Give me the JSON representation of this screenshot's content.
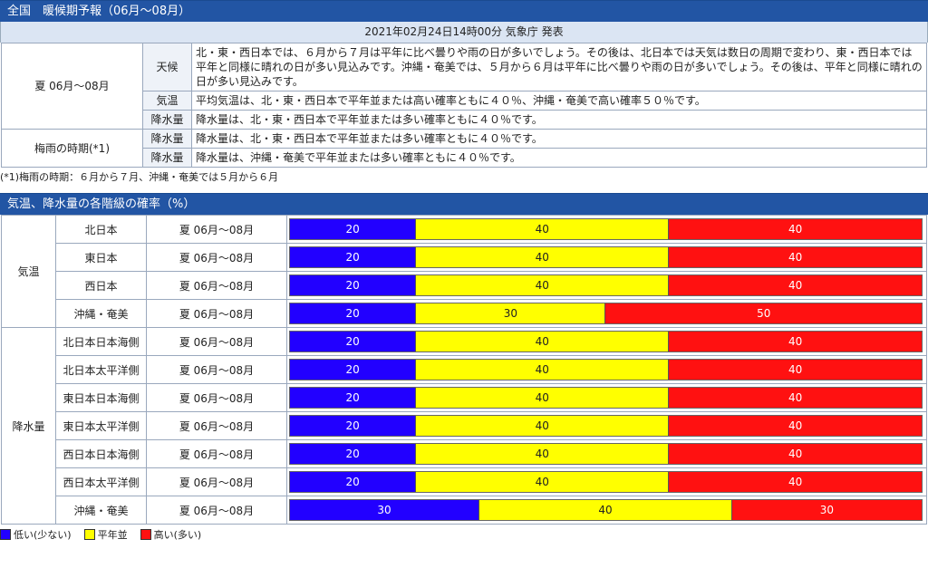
{
  "header": {
    "title": "全国　暖候期予報（06月～08月）"
  },
  "issued": "2021年02月24日14時00分 気象庁 発表",
  "forecast": {
    "summer_period": "夏 06月～08月",
    "weather_label": "天候",
    "weather_text": "北・東・西日本では、６月から７月は平年に比べ曇りや雨の日が多いでしょう。その後は、北日本では天気は数日の周期で変わり、東・西日本では平年と同様に晴れの日が多い見込みです。沖縄・奄美では、５月から６月は平年に比べ曇りや雨の日が多いでしょう。その後は、平年と同様に晴れの日が多い見込みです。",
    "temp_label": "気温",
    "temp_text": "平均気温は、北・東・西日本で平年並または高い確率ともに４０％、沖縄・奄美で高い確率５０％です。",
    "precip_label": "降水量",
    "precip_text": "降水量は、北・東・西日本で平年並または多い確率ともに４０％です。",
    "rainy_period": "梅雨の時期(*1)",
    "rainy_label1": "降水量",
    "rainy_text1": "降水量は、北・東・西日本で平年並または多い確率ともに４０％です。",
    "rainy_label2": "降水量",
    "rainy_text2": "降水量は、沖縄・奄美で平年並または多い確率ともに４０％です。"
  },
  "note": "(*1)梅雨の時期：６月から７月、沖縄・奄美では５月から６月",
  "prob_header": "気温、降水量の各階級の確率（%）",
  "colors": {
    "low": "#2200ff",
    "normal": "#ffff00",
    "high": "#ff1111",
    "header": "#2255a4"
  },
  "temp_group": {
    "label": "気温",
    "rows": [
      {
        "region": "北日本",
        "period": "夏 06月～08月",
        "low": 20,
        "normal": 40,
        "high": 40
      },
      {
        "region": "東日本",
        "period": "夏 06月～08月",
        "low": 20,
        "normal": 40,
        "high": 40
      },
      {
        "region": "西日本",
        "period": "夏 06月～08月",
        "low": 20,
        "normal": 40,
        "high": 40
      },
      {
        "region": "沖縄・奄美",
        "period": "夏 06月～08月",
        "low": 20,
        "normal": 30,
        "high": 50
      }
    ]
  },
  "precip_group": {
    "label": "降水量",
    "rows": [
      {
        "region": "北日本日本海側",
        "period": "夏 06月～08月",
        "low": 20,
        "normal": 40,
        "high": 40
      },
      {
        "region": "北日本太平洋側",
        "period": "夏 06月～08月",
        "low": 20,
        "normal": 40,
        "high": 40
      },
      {
        "region": "東日本日本海側",
        "period": "夏 06月～08月",
        "low": 20,
        "normal": 40,
        "high": 40
      },
      {
        "region": "東日本太平洋側",
        "period": "夏 06月～08月",
        "low": 20,
        "normal": 40,
        "high": 40
      },
      {
        "region": "西日本日本海側",
        "period": "夏 06月～08月",
        "low": 20,
        "normal": 40,
        "high": 40
      },
      {
        "region": "西日本太平洋側",
        "period": "夏 06月～08月",
        "low": 20,
        "normal": 40,
        "high": 40
      },
      {
        "region": "沖縄・奄美",
        "period": "夏 06月～08月",
        "low": 30,
        "normal": 40,
        "high": 30
      }
    ]
  },
  "legend": {
    "low": "低い(少ない)",
    "normal": "平年並",
    "high": "高い(多い)"
  }
}
